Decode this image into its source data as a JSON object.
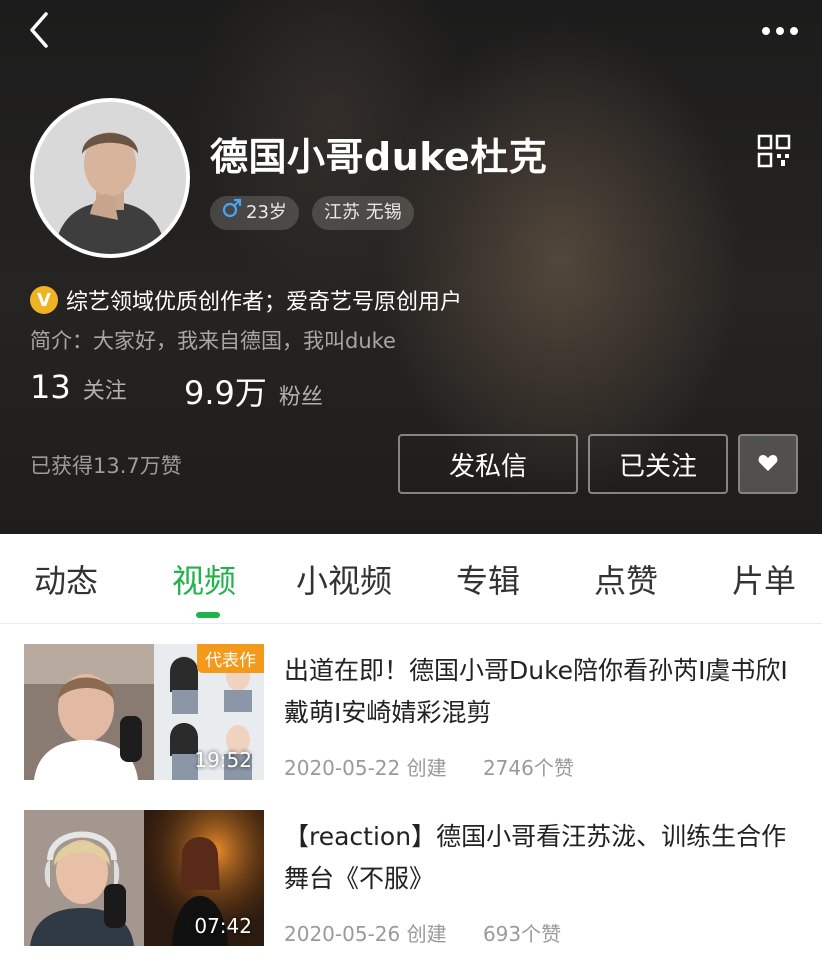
{
  "header": {
    "name": "德国小哥duke杜克",
    "age_tag": "23岁",
    "location_tag": "江苏 无锡",
    "certification": "综艺领域优质创作者；爱奇艺号原创用户",
    "bio": "简介：大家好，我来自德国，我叫duke",
    "stats": {
      "following_count": "13",
      "following_label": "关注",
      "fans_count": "9.9万",
      "fans_label": "粉丝"
    },
    "likes_received": "已获得13.7万赞",
    "buttons": {
      "message": "发私信",
      "followed": "已关注"
    },
    "icons": {
      "back": "back-arrow-icon",
      "more": "more-dots-icon",
      "qr": "qr-code-icon",
      "gender": "male-icon",
      "verified": "verified-v-icon",
      "heart_dropdown": "chevron-down-icon"
    }
  },
  "tabs": [
    {
      "label": "动态",
      "active": false
    },
    {
      "label": "视频",
      "active": true
    },
    {
      "label": "小视频",
      "active": false
    },
    {
      "label": "专辑",
      "active": false
    },
    {
      "label": "点赞",
      "active": false
    },
    {
      "label": "片单",
      "active": false
    }
  ],
  "videos": [
    {
      "title": "出道在即！德国小哥Duke陪你看孙芮I虞书欣I戴萌I安崎婧彩混剪",
      "duration": "19:52",
      "badge": "代表作",
      "date": "2020-05-22 创建",
      "likes": "2746个赞"
    },
    {
      "title": "【reaction】德国小哥看汪苏泷、训练生合作舞台《不服》",
      "duration": "07:42",
      "date": "2020-05-26 创建",
      "likes": "693个赞"
    }
  ],
  "colors": {
    "accent_green": "#21b24a",
    "badge_orange": "#f39a1b",
    "verified_gold": "#f0b323"
  }
}
